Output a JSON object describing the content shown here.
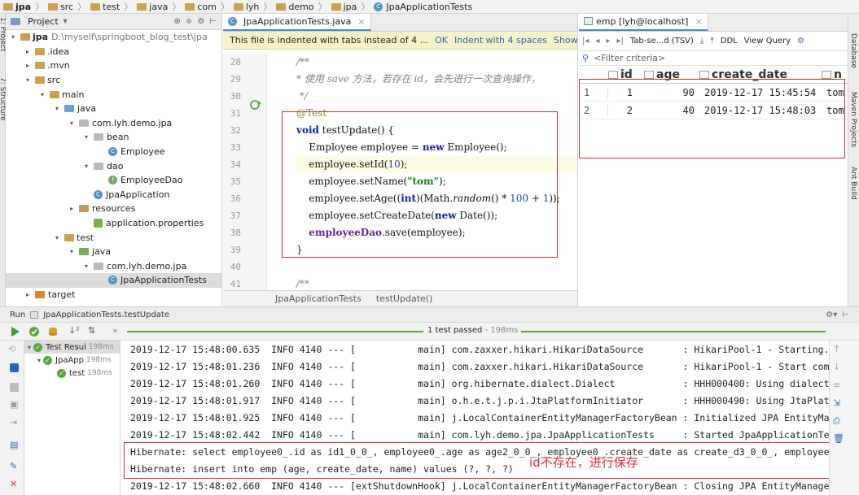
{
  "breadcrumb": [
    "jpa",
    "src",
    "test",
    "java",
    "com",
    "lyh",
    "demo",
    "jpa",
    "JpaApplicationTests"
  ],
  "left_strip": {
    "top": "1: Project",
    "bottom": "7: Structure"
  },
  "project": {
    "title": "Project",
    "tree": [
      {
        "label": "jpa",
        "path": "D:\\myself\\springboot_blog_test\\jpa",
        "kind": "root"
      },
      {
        "label": ".idea",
        "kind": "folder"
      },
      {
        "label": ".mvn",
        "kind": "folder"
      },
      {
        "label": "src",
        "kind": "folder"
      },
      {
        "label": "main",
        "kind": "folder"
      },
      {
        "label": "java",
        "kind": "src"
      },
      {
        "label": "com.lyh.demo.jpa",
        "kind": "pkg"
      },
      {
        "label": "bean",
        "kind": "pkg"
      },
      {
        "label": "Employee",
        "kind": "class"
      },
      {
        "label": "dao",
        "kind": "pkg"
      },
      {
        "label": "EmployeeDao",
        "kind": "iface"
      },
      {
        "label": "JpaApplication",
        "kind": "spring"
      },
      {
        "label": "resources",
        "kind": "res"
      },
      {
        "label": "application.properties",
        "kind": "leaf"
      },
      {
        "label": "test",
        "kind": "folder"
      },
      {
        "label": "java",
        "kind": "testsrc"
      },
      {
        "label": "com.lyh.demo.jpa",
        "kind": "pkg"
      },
      {
        "label": "JpaApplicationTests",
        "kind": "class"
      },
      {
        "label": "target",
        "kind": "target"
      }
    ]
  },
  "editor": {
    "tab": "JpaApplicationTests.java",
    "notification": "This file is indented with tabs instead of 4 ...",
    "notif_links": [
      "OK",
      "Indent with 4 spaces",
      "Show Settings"
    ],
    "line_numbers": [
      "28",
      "29",
      "30",
      "31",
      "32",
      "33",
      "34",
      "35",
      "36",
      "37",
      "38",
      "39",
      "40",
      "41"
    ],
    "comment_line": "* 使用 save 方法，若存在 id，会先进行一次查询操作，",
    "breadcrumb": [
      "JpaApplicationTests",
      "testUpdate()"
    ]
  },
  "db": {
    "tab": "emp [lyh@localhost]",
    "toolbar": {
      "format": "Tab-se...d (TSV)",
      "ddl": "DDL",
      "view_query": "View Query"
    },
    "filter": "<Filter criteria>",
    "columns": [
      "id",
      "age",
      "create_date",
      "n"
    ],
    "rows": [
      {
        "row": "1",
        "id": "1",
        "age": "90",
        "create_date": "2019-12-17 15:45:54",
        "name": "tom"
      },
      {
        "row": "2",
        "id": "2",
        "age": "40",
        "create_date": "2019-12-17 15:48:03",
        "name": "tom"
      }
    ]
  },
  "right_strip": [
    "Database",
    "Maven Projects",
    "Ant Build"
  ],
  "run": {
    "label": "Run",
    "config": "JpaApplicationTests.testUpdate",
    "status": "1 test passed",
    "duration": "- 198ms",
    "tree": [
      {
        "label": "Test Resul",
        "time": "198ms"
      },
      {
        "label": "JpaApp",
        "time": "198ms"
      },
      {
        "label": "test",
        "time": "198ms"
      }
    ],
    "console": [
      "2019-12-17 15:48:00.635  INFO 4140 --- [           main] com.zaxxer.hikari.HikariDataSource       : HikariPool-1 - Starting...",
      "2019-12-17 15:48:01.236  INFO 4140 --- [           main] com.zaxxer.hikari.HikariDataSource       : HikariPool-1 - Start complet",
      "2019-12-17 15:48:01.260  INFO 4140 --- [           main] org.hibernate.dialect.Dialect            : HHH000400: Using dialect: or",
      "2019-12-17 15:48:01.917  INFO 4140 --- [           main] o.h.e.t.j.p.i.JtaPlatformInitiator       : HHH000490: Using JtaPlatform",
      "2019-12-17 15:48:01.925  INFO 4140 --- [           main] j.LocalContainerEntityManagerFactoryBean : Initialized JPA EntityManage",
      "2019-12-17 15:48:02.442  INFO 4140 --- [           main] com.lyh.demo.jpa.JpaApplicationTests     : Started JpaApplicationTests",
      "Hibernate: select employee0_.id as id1_0_0_, employee0_.age as age2_0_0_, employee0_.create_date as create_d3_0_0_, employee0_.n",
      "Hibernate: insert into emp (age, create_date, name) values (?, ?, ?)",
      "2019-12-17 15:48:02.660  INFO 4140 --- [extShutdownHook] j.LocalContainerEntityManagerFactoryBean : Closing JPA EntityManagerFac"
    ],
    "annotation": "id不存在，进行保存"
  },
  "colors": {
    "annotation_red": "#e02828",
    "pass_green": "#59a83c",
    "accent_blue": "#4a86c8"
  }
}
